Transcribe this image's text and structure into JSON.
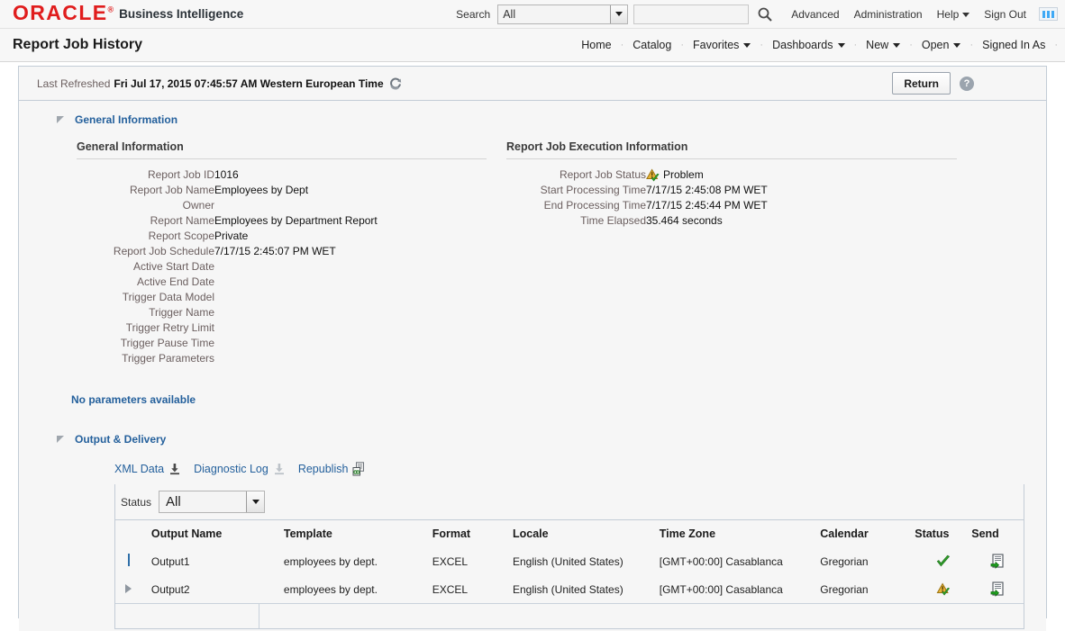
{
  "header": {
    "brand": "ORACLE",
    "brand_reg": "®",
    "product": "Business Intelligence",
    "search_label": "Search",
    "search_scope_value": "All",
    "search_placeholder": "",
    "search_value": "",
    "search_icon": "search-icon",
    "links": [
      {
        "label": "Advanced",
        "caret": false
      },
      {
        "label": "Administration",
        "caret": false
      },
      {
        "label": "Help",
        "caret": true
      },
      {
        "label": "Sign Out",
        "caret": false
      }
    ],
    "grid_icon": "app-grid-icon",
    "brand_color": "#e01d1d"
  },
  "page": {
    "title": "Report Job History",
    "nav": [
      {
        "label": "Home",
        "caret": false
      },
      {
        "label": "Catalog",
        "caret": false
      },
      {
        "label": "Favorites",
        "caret": true
      },
      {
        "label": "Dashboards",
        "caret": true
      },
      {
        "label": "New",
        "caret": true
      },
      {
        "label": "Open",
        "caret": true
      },
      {
        "label": "Signed In As",
        "caret": false
      }
    ]
  },
  "refresh_bar": {
    "label": "Last Refreshed",
    "value": "Fri Jul 17, 2015 07:45:57 AM Western European Time",
    "refresh_icon": "refresh-icon",
    "return_button": "Return",
    "help_icon": "help-icon",
    "help_glyph": "?"
  },
  "general_section": {
    "section_label": "General Information",
    "left": {
      "title": "General Information",
      "rows": [
        {
          "label": "Report Job ID",
          "value": "1016"
        },
        {
          "label": "Report Job Name",
          "value": "Employees by Dept"
        },
        {
          "label": "Owner",
          "value": ""
        },
        {
          "label": "Report Name",
          "value": "Employees by Department Report"
        },
        {
          "label": "Report Scope",
          "value": "Private"
        },
        {
          "label": "Report Job Schedule",
          "value": "7/17/15 2:45:07 PM WET"
        },
        {
          "label": "Active Start Date",
          "value": ""
        },
        {
          "label": "Active End Date",
          "value": ""
        },
        {
          "label": "Trigger Data Model",
          "value": ""
        },
        {
          "label": "Trigger Name",
          "value": ""
        },
        {
          "label": "Trigger Retry Limit",
          "value": ""
        },
        {
          "label": "Trigger Pause Time",
          "value": ""
        },
        {
          "label": "Trigger Parameters",
          "value": ""
        }
      ]
    },
    "right": {
      "title": "Report Job Execution Information",
      "status_label": "Report Job Status",
      "status_value": "Problem",
      "status_icon": "warning-check-icon",
      "rows": [
        {
          "label": "Start Processing Time",
          "value": "7/17/15 2:45:08 PM WET"
        },
        {
          "label": "End Processing Time",
          "value": "7/17/15 2:45:44 PM WET"
        },
        {
          "label": "Time Elapsed",
          "value": "35.464 seconds"
        }
      ]
    }
  },
  "no_parameters": "No parameters available",
  "output_section": {
    "section_label": "Output & Delivery",
    "links": [
      {
        "label": "XML Data",
        "icon": "download-icon",
        "enabled": true
      },
      {
        "label": "Diagnostic Log",
        "icon": "download-icon",
        "enabled": false
      },
      {
        "label": "Republish",
        "icon": "republish-icon",
        "enabled": true
      }
    ],
    "filter": {
      "label": "Status",
      "value": "All"
    },
    "table": {
      "columns": [
        "Output Name",
        "Template",
        "Format",
        "Locale",
        "Time Zone",
        "Calendar",
        "Status",
        "Send"
      ],
      "rows": [
        {
          "expander": "selected-bar",
          "output_name": "Output1",
          "template": "employees by dept.",
          "format": "EXCEL",
          "locale": "English (United States)",
          "time_zone": "[GMT+00:00] Casablanca",
          "calendar": "Gregorian",
          "status_icon": "success-check-icon",
          "send_icon": "send-document-icon"
        },
        {
          "expander": "collapsed-triangle",
          "output_name": "Output2",
          "template": "employees by dept.",
          "format": "EXCEL",
          "locale": "English (United States)",
          "time_zone": "[GMT+00:00] Casablanca",
          "calendar": "Gregorian",
          "status_icon": "warning-check-icon",
          "send_icon": "send-document-icon"
        }
      ]
    }
  },
  "colors": {
    "link_blue": "#24609c",
    "label_brown": "#6b5f5f",
    "border": "#c3ccd6",
    "panel_bg": "#f6f6f6",
    "success_green": "#3aa02c",
    "warning_amber": "#d8a227"
  }
}
